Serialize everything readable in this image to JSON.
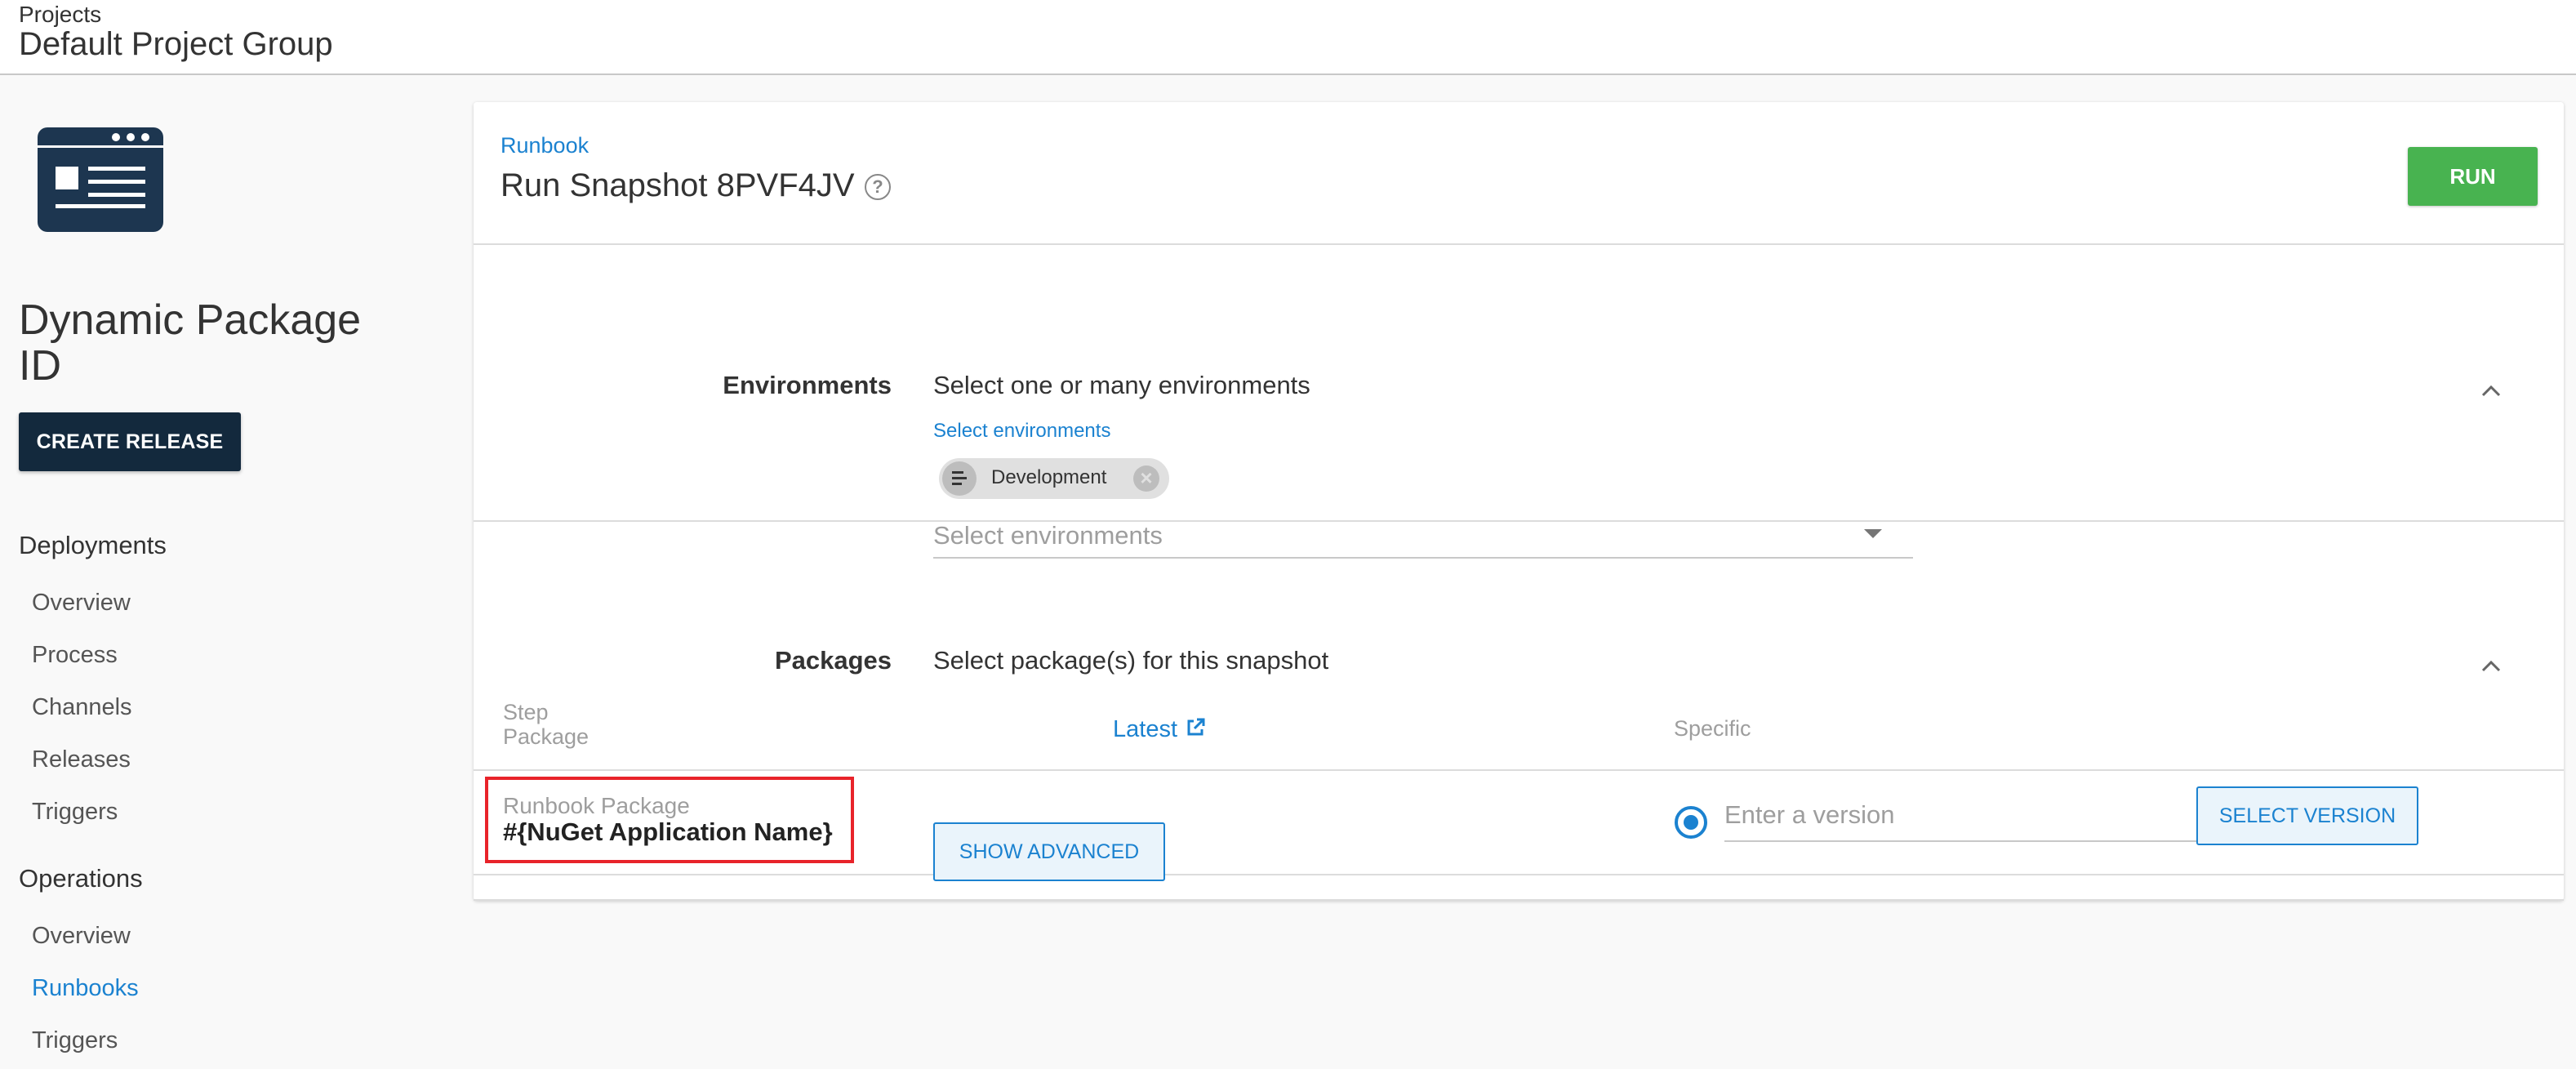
{
  "header": {
    "breadcrumb": "Projects",
    "title": "Default Project Group"
  },
  "sidebar": {
    "project_name": "Dynamic Package ID",
    "create_release_label": "CREATE RELEASE",
    "deployments_heading": "Deployments",
    "deployments_items": [
      "Overview",
      "Process",
      "Channels",
      "Releases",
      "Triggers"
    ],
    "operations_heading": "Operations",
    "operations_items": [
      "Overview",
      "Runbooks",
      "Triggers"
    ],
    "active_item": "Runbooks"
  },
  "card": {
    "runbook_link": "Runbook",
    "title": "Run Snapshot 8PVF4JV",
    "help_icon": "question-circle-icon",
    "run_label": "RUN"
  },
  "environments": {
    "label": "Environments",
    "description": "Select one or many environments",
    "select_label": "Select environments",
    "selected_chip": "Development",
    "placeholder": "Select environments"
  },
  "packages": {
    "label": "Packages",
    "description": "Select package(s) for this snapshot",
    "col_step": "Step",
    "col_package": "Package",
    "col_latest": "Latest",
    "col_specific": "Specific",
    "row": {
      "step": "Runbook Package",
      "package": "#{NuGet Application Name}",
      "version_placeholder": "Enter a version",
      "select_version_label": "SELECT VERSION"
    },
    "show_advanced_label": "SHOW ADVANCED"
  },
  "colors": {
    "accent": "#1b82d0",
    "run_green": "#48b350",
    "dark_navy": "#13293d",
    "highlight_red": "#e8232a"
  }
}
